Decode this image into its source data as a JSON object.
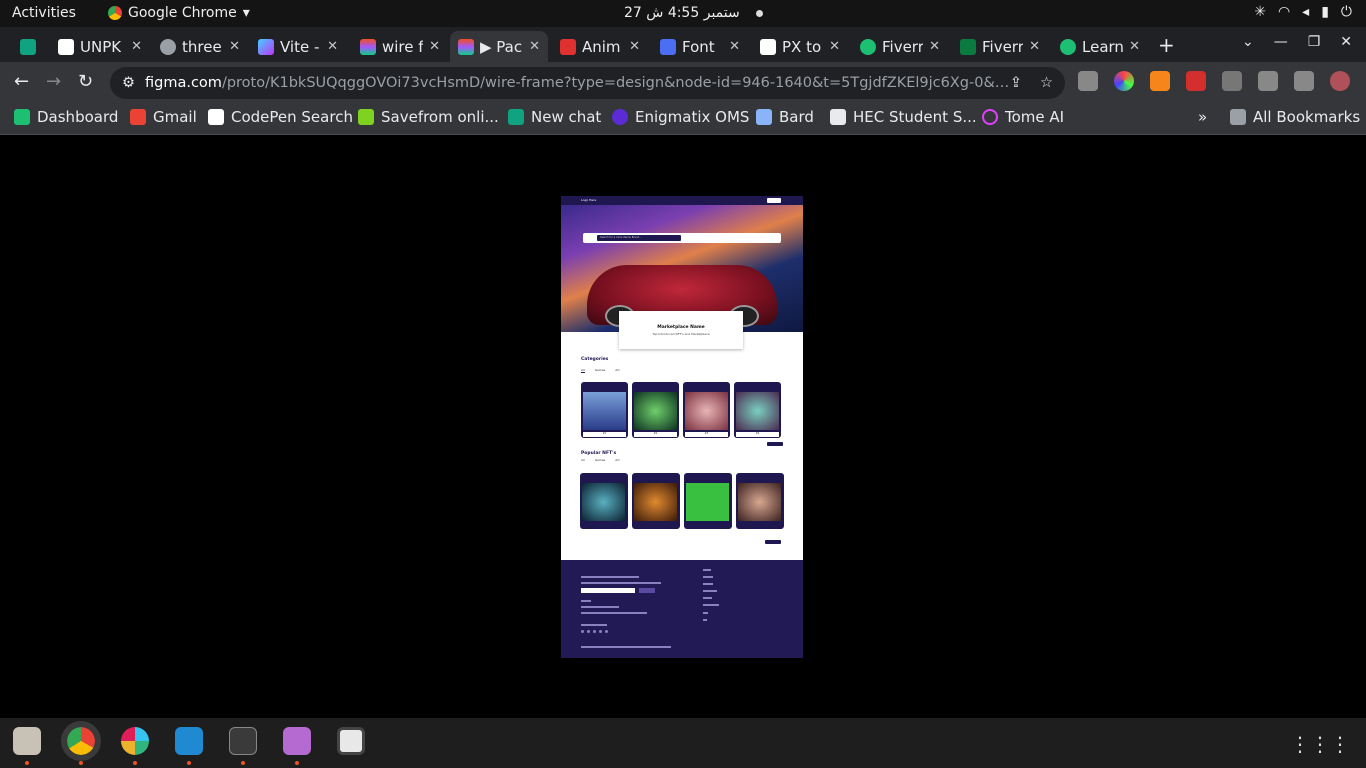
{
  "os_bar": {
    "activities": "Activities",
    "app_name": "Google Chrome",
    "clock": "27 ستمبر  4:55 ش"
  },
  "tabs": [
    {
      "title": "",
      "color": "#10a37f"
    },
    {
      "title": "UNPK",
      "color": "#ffffff"
    },
    {
      "title": "three",
      "color": "#9aa0a6"
    },
    {
      "title": "Vite -",
      "color": "#a259ff"
    },
    {
      "title": "wire f",
      "color": "#f24e1e"
    },
    {
      "title": "▶ Pac",
      "color": "#a259ff"
    },
    {
      "title": "Anim",
      "color": "#e03131"
    },
    {
      "title": "Font",
      "color": "#4c6ef5"
    },
    {
      "title": "PX to",
      "color": "#ffffff"
    },
    {
      "title": "Fiverr",
      "color": "#1dbf73"
    },
    {
      "title": "Fiverr",
      "color": "#0b7a3e"
    },
    {
      "title": "Learn",
      "color": "#1dbf73"
    }
  ],
  "address_bar": {
    "host": "figma.com",
    "path": "/proto/K1bkSUQqggOVOi73vcHsmD/wire-frame?type=design&node-id=946-1640&t=5TgjdfZKEl9jc6Xg-0&scaling=scale-do..."
  },
  "bookmarks": [
    {
      "label": "Dashboard",
      "color": "#1dbf73"
    },
    {
      "label": "Gmail",
      "color": "#ea4335"
    },
    {
      "label": "CodePen Search",
      "color": "#ffffff"
    },
    {
      "label": "Savefrom onli...",
      "color": "#7ed321"
    },
    {
      "label": "New chat",
      "color": "#10a37f"
    },
    {
      "label": "Enigmatix OMS",
      "color": "#5b2bd6"
    },
    {
      "label": "Bard",
      "color": "#8ab4f8"
    },
    {
      "label": "HEC Student S...",
      "color": "#e8eaed"
    },
    {
      "label": "Tome AI",
      "color": "#e040fb"
    }
  ],
  "all_bookmarks": "All Bookmarks",
  "prototype": {
    "nav_logo": "Logo Here",
    "search_placeholder": "Search for a more items/ Brand...",
    "hero_card_title": "Marketplace Name",
    "hero_card_subtitle": "Top Introduced NFT's and Marketplace",
    "categories_title": "Categories",
    "category_tabs": [
      "All",
      "Games",
      "Art"
    ],
    "category_cards": [
      "#1",
      "#2",
      "#3",
      "#4"
    ],
    "popular_title": "Popular NFT's",
    "popular_tabs": [
      "All",
      "Games",
      "Art"
    ]
  },
  "colors": {
    "frame_navy": "#1e1750",
    "footer_bg": "#221a55"
  }
}
